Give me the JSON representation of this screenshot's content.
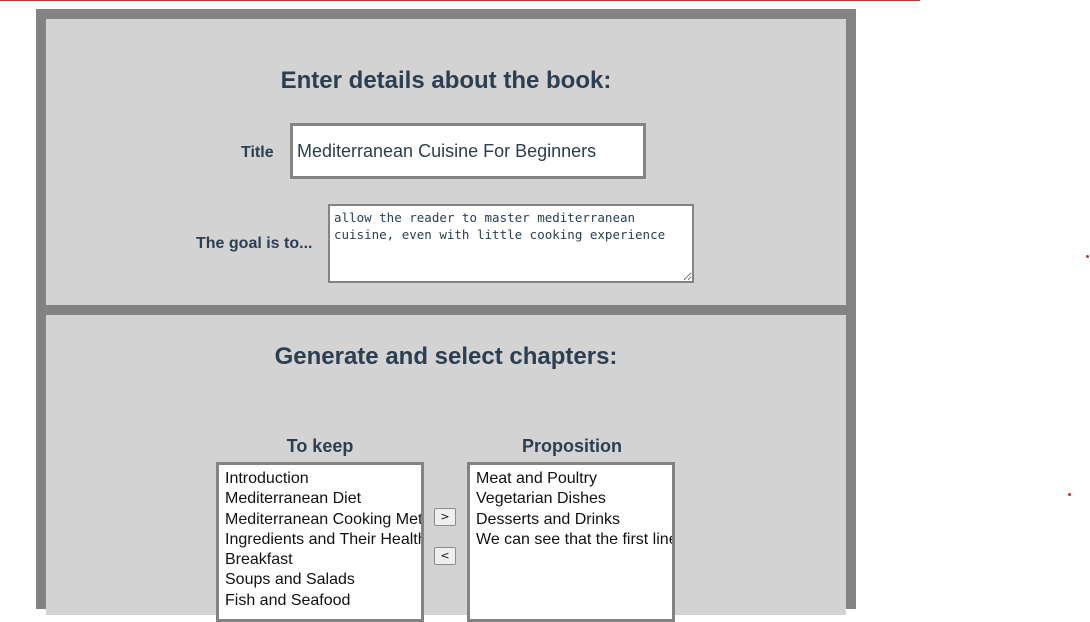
{
  "book_section": {
    "heading": "Enter details about the book:",
    "title_label": "Title",
    "title_value": "Mediterranean Cuisine For Beginners",
    "goal_label": "The goal is to...",
    "goal_value": "allow the reader to master mediterranean cuisine, even with little cooking experience"
  },
  "chapters_section": {
    "heading": "Generate and select chapters:",
    "keep_header": "To keep",
    "proposition_header": "Proposition",
    "move_right_label": ">",
    "move_left_label": "<",
    "keep_items": [
      "Introduction",
      "Mediterranean Diet",
      "Mediterranean Cooking Methods",
      "Ingredients and Their Health Benefits",
      "Breakfast",
      "Soups and Salads",
      "Fish and Seafood"
    ],
    "proposition_items": [
      "Meat and Poultry",
      "Vegetarian Dishes",
      "Desserts and Drinks",
      "We can see that the first line"
    ]
  },
  "colors": {
    "frame": "#838383",
    "panel": "#d3d3d3",
    "text": "#2c3e50",
    "accent_red": "#c0392b"
  }
}
